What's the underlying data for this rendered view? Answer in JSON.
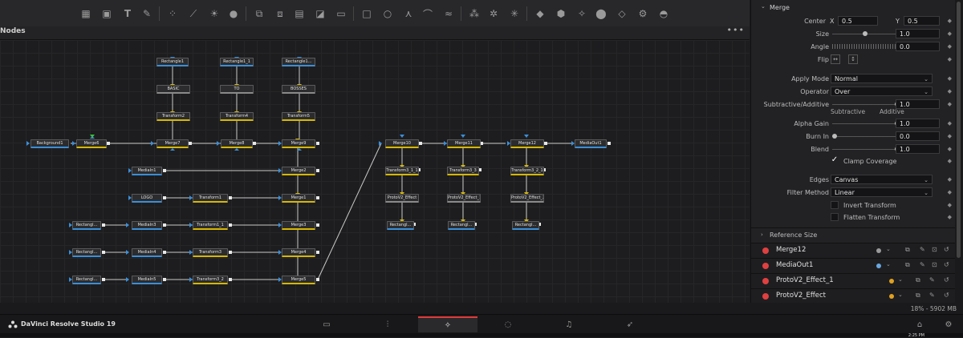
{
  "nodes_panel": {
    "title": "Nodes",
    "menu": "•••"
  },
  "toolbar": {
    "icons": [
      "background-icon",
      "image-icon",
      "text-icon",
      "paint-icon",
      "particles-icon",
      "polygon-icon",
      "bright-contrast-icon",
      "blur-icon",
      "merge-icon",
      "3d-merge-icon",
      "channel-icon",
      "mask-icon",
      "loader-icon",
      "rect-mask-icon",
      "circle-mask-icon",
      "bspline-icon",
      "bezier-icon",
      "polyline-icon",
      "particle-emitter-icon",
      "particle-render-icon",
      "particle-gen-icon",
      "3d-shape-icon",
      "3d-camera-icon",
      "3d-light-icon",
      "3d-render-icon",
      "3d-image-icon",
      "3d-renderer-icon",
      "3d-text-icon"
    ]
  },
  "nodes": {
    "rect1": "Rectangle1",
    "rect1_1": "Rectangle1_1",
    "rect1_2": "Rectangle1...",
    "basic": "BASIC",
    "to": "TO",
    "bosses": "BOSSES",
    "xf2": "Transform2",
    "xf4": "Transform4",
    "xf5": "Transform5",
    "bg1": "Background1",
    "merge6": "Merge6",
    "merge7": "Merge7",
    "merge8": "Merge8",
    "merge9": "Merge9",
    "media1": "MediaIn1",
    "merge2": "Merge2",
    "logo": "LOGO",
    "xf1": "Transform1",
    "merge1": "Merge1",
    "rectA": "Rectangl...",
    "media3": "MediaIn3",
    "xf1_1": "Transform1_1",
    "merge3": "Merge3",
    "rectB": "Rectangl...",
    "media4": "MediaIn4",
    "xf3": "Transform3",
    "merge4": "Merge4",
    "rectC": "Rectangl...",
    "media5": "MediaIn5",
    "xf3_2": "Transform3_2",
    "merge5": "Merge5",
    "merge10": "Merge10",
    "merge11": "Merge11",
    "merge12": "Merge12",
    "mediaout": "MediaOut1",
    "xf3_1_1": "Transform3_1_1",
    "xf3_3": "Transform3_3",
    "xf3_2_1": "Transform3_2_1",
    "proto": "ProtoV2_Effect",
    "proto1": "ProtoV2_Effect_1",
    "proto2": "ProtoV2_Effect_2",
    "rectD": "Rectangl...",
    "rectE": "Rectangl...",
    "rectF": "Rectangl..."
  },
  "inspector": {
    "header": "Merge",
    "center_label": "Center",
    "center_x_label": "X",
    "center_x": "0.5",
    "center_y_label": "Y",
    "center_y": "0.5",
    "size_label": "Size",
    "size": "1.0",
    "angle_label": "Angle",
    "angle": "0.0",
    "flip_label": "Flip",
    "apply_mode_label": "Apply Mode",
    "apply_mode": "Normal",
    "operator_label": "Operator",
    "operator": "Over",
    "sub_add_label": "Subtractive/Additive",
    "sub_add": "1.0",
    "subtractive": "Subtractive",
    "additive": "Additive",
    "alpha_gain_label": "Alpha Gain",
    "alpha_gain": "1.0",
    "burn_in_label": "Burn In",
    "burn_in": "0.0",
    "blend_label": "Blend",
    "blend": "1.0",
    "clamp_label": "Clamp Coverage",
    "clamp_checked": "✓",
    "edges_label": "Edges",
    "edges": "Canvas",
    "filter_label": "Filter Method",
    "filter": "Linear",
    "invert_label": "Invert Transform",
    "flatten_label": "Flatten Transform",
    "reference_size": "Reference Size"
  },
  "layers": [
    {
      "name": "Merge12",
      "color": "#9a9a9a"
    },
    {
      "name": "MediaOut1",
      "color": "#6aa7e0"
    },
    {
      "name": "ProtoV2_Effect_1",
      "color": "#e0a020"
    },
    {
      "name": "ProtoV2_Effect",
      "color": "#e0a020"
    }
  ],
  "status": {
    "memory": "18% - 5902 MB"
  },
  "app": {
    "name": "DaVinci Resolve Studio 19"
  },
  "pages": [
    "media-page-icon",
    "cut-page-icon",
    "fusion-page-icon",
    "color-page-icon",
    "fairlight-page-icon",
    "deliver-page-icon"
  ],
  "taskbar": {
    "time": "2:25 PM"
  },
  "colors": {
    "accent": "#e03b3b",
    "merge_link": "#d6b800",
    "source_link": "#3a8fd9"
  }
}
